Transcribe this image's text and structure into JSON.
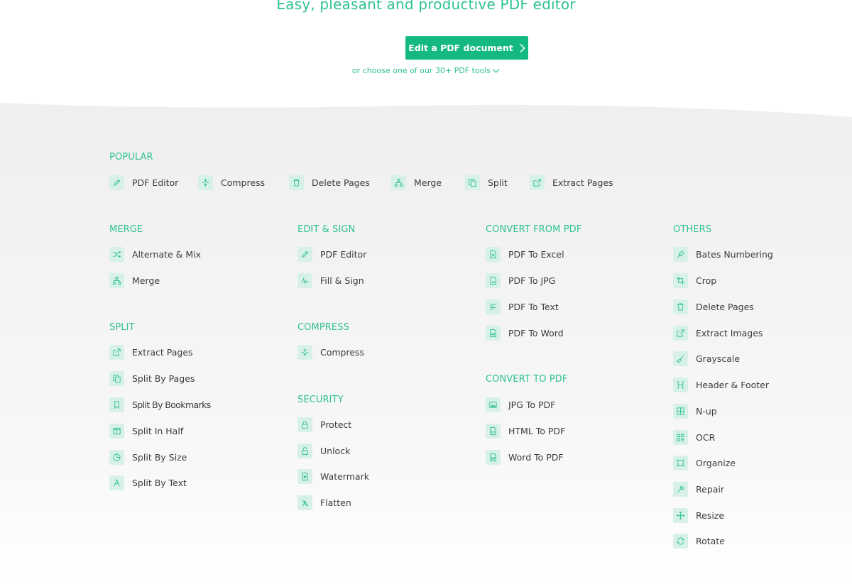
{
  "hero": {
    "title": "Easy, pleasant and productive PDF editor",
    "cta_label": "Edit a PDF document",
    "more_tools": "or choose one of our 30+ PDF tools"
  },
  "colors": {
    "accent": "#14b981",
    "accent_text": "#2ec28e",
    "icon_bg": "#d8f1e7",
    "section_bg": "#f1f1f1"
  },
  "popular": {
    "title": "POPULAR",
    "items": [
      {
        "label": "PDF Editor",
        "icon": "pencil-icon"
      },
      {
        "label": "Compress",
        "icon": "compress-icon"
      },
      {
        "label": "Delete Pages",
        "icon": "trash-icon"
      },
      {
        "label": "Merge",
        "icon": "merge-icon"
      },
      {
        "label": "Split",
        "icon": "split-icon"
      },
      {
        "label": "Extract Pages",
        "icon": "extract-icon"
      }
    ]
  },
  "merge": {
    "title": "MERGE",
    "items": [
      {
        "label": "Alternate & Mix",
        "icon": "shuffle-icon"
      },
      {
        "label": "Merge",
        "icon": "merge-icon"
      }
    ]
  },
  "split": {
    "title": "SPLIT",
    "items": [
      {
        "label": "Extract Pages",
        "icon": "extract-icon"
      },
      {
        "label": "Split By Pages",
        "icon": "split-icon"
      },
      {
        "label": "Split By Bookmarks",
        "icon": "bookmark-icon"
      },
      {
        "label": "Split In Half",
        "icon": "half-icon"
      },
      {
        "label": "Split By Size",
        "icon": "pie-icon"
      },
      {
        "label": "Split By Text",
        "icon": "text-a-icon"
      }
    ]
  },
  "edit_sign": {
    "title": "EDIT & SIGN",
    "items": [
      {
        "label": "PDF Editor",
        "icon": "pencil-icon"
      },
      {
        "label": "Fill & Sign",
        "icon": "signature-icon"
      }
    ]
  },
  "compress": {
    "title": "COMPRESS",
    "items": [
      {
        "label": "Compress",
        "icon": "compress-icon"
      }
    ]
  },
  "security": {
    "title": "SECURITY",
    "items": [
      {
        "label": "Protect",
        "icon": "lock-icon"
      },
      {
        "label": "Unlock",
        "icon": "unlock-icon"
      },
      {
        "label": "Watermark",
        "icon": "watermark-icon"
      },
      {
        "label": "Flatten",
        "icon": "flatten-icon"
      }
    ]
  },
  "convert_from": {
    "title": "CONVERT FROM PDF",
    "items": [
      {
        "label": "PDF To Excel",
        "icon": "excel-file-icon"
      },
      {
        "label": "PDF To JPG",
        "icon": "image-file-icon"
      },
      {
        "label": "PDF To Text",
        "icon": "text-lines-icon"
      },
      {
        "label": "PDF To Word",
        "icon": "word-file-icon"
      }
    ]
  },
  "convert_to": {
    "title": "CONVERT TO PDF",
    "items": [
      {
        "label": "JPG To PDF",
        "icon": "image-icon"
      },
      {
        "label": "HTML To PDF",
        "icon": "html-file-icon"
      },
      {
        "label": "Word To PDF",
        "icon": "word-file-icon"
      }
    ]
  },
  "others": {
    "title": "OTHERS",
    "items": [
      {
        "label": "Bates Numbering",
        "icon": "stamp-icon"
      },
      {
        "label": "Crop",
        "icon": "crop-icon"
      },
      {
        "label": "Delete Pages",
        "icon": "trash-icon"
      },
      {
        "label": "Extract Images",
        "icon": "extract-icon"
      },
      {
        "label": "Grayscale",
        "icon": "brush-icon"
      },
      {
        "label": "Header & Footer",
        "icon": "header-icon"
      },
      {
        "label": "N-up",
        "icon": "grid-icon"
      },
      {
        "label": "OCR",
        "icon": "ocr-icon"
      },
      {
        "label": "Organize",
        "icon": "organize-icon"
      },
      {
        "label": "Repair",
        "icon": "wrench-icon"
      },
      {
        "label": "Resize",
        "icon": "resize-icon"
      },
      {
        "label": "Rotate",
        "icon": "rotate-icon"
      }
    ]
  }
}
